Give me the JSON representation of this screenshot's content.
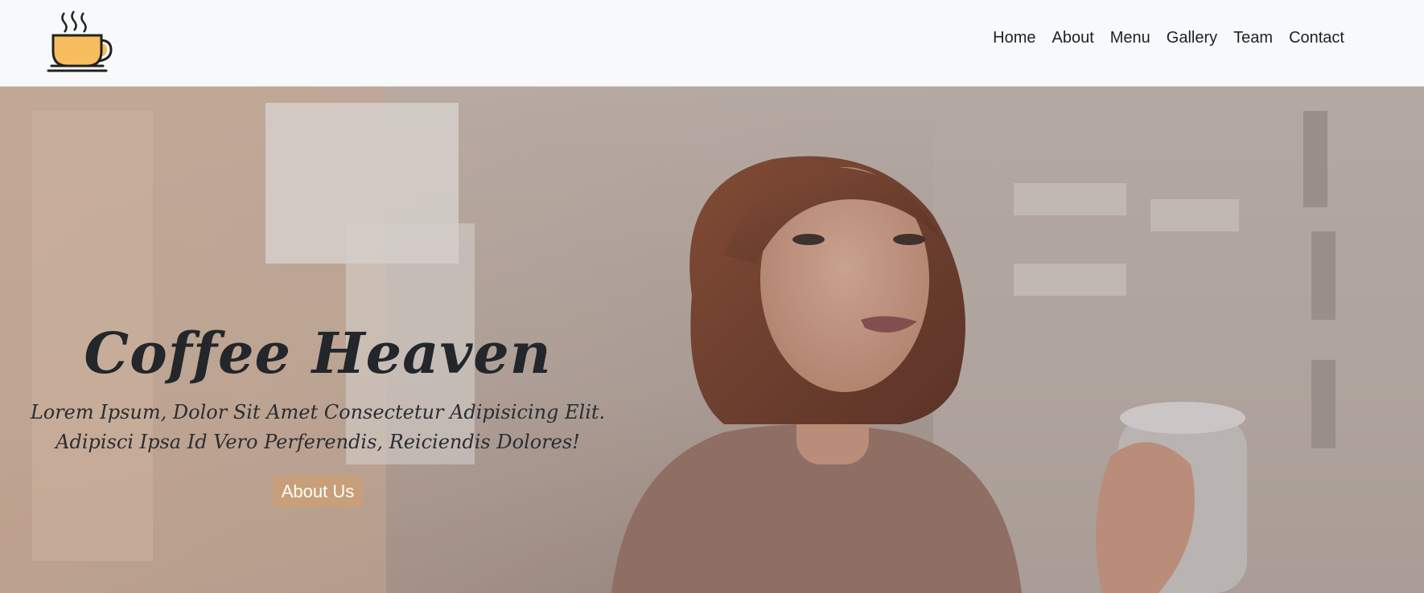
{
  "brand": {
    "logo_icon": "coffee-cup-icon"
  },
  "nav": {
    "items": [
      {
        "label": "Home"
      },
      {
        "label": "About"
      },
      {
        "label": "Menu"
      },
      {
        "label": "Gallery"
      },
      {
        "label": "Team"
      },
      {
        "label": "Contact"
      }
    ]
  },
  "hero": {
    "title": "Coffee Heaven",
    "subtitle_line1": "Lorem Ipsum, Dolor Sit Amet Consectetur Adipisicing Elit.",
    "subtitle_line2": "Adipisci Ipsa Id Vero Perferendis, Reiciendis Dolores!",
    "button_label": "About Us",
    "background_image": "woman-holding-coffee-mug-photo"
  },
  "colors": {
    "accent": "#c89f78",
    "navbar_bg": "#f8f9fa",
    "cup_fill": "#f7bd5e",
    "title_text": "#23262a"
  }
}
